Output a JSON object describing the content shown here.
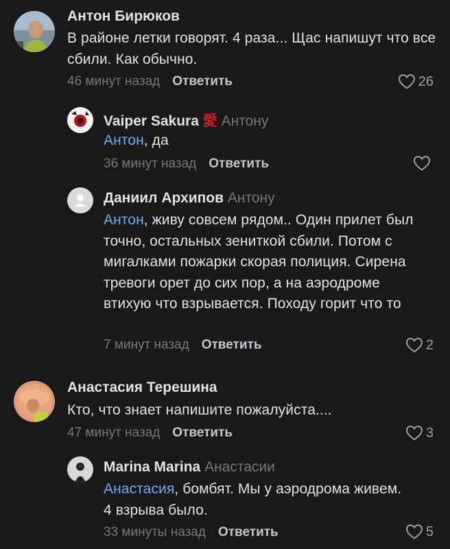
{
  "comments": [
    {
      "author": "Антон Бирюков",
      "text": "В районе летки говорят. 4 раза... Щас напишут что все сбили. Как обычно.",
      "time": "46 минут назад",
      "reply_label": "Ответить",
      "likes": "26",
      "replies": [
        {
          "author": "Vaiper Sakura",
          "emblem": "愛",
          "reply_to": "Антону",
          "mention": "Антон",
          "text": ", да",
          "time": "36 минут назад",
          "reply_label": "Ответить",
          "likes": ""
        },
        {
          "author": "Даниил Архипов",
          "reply_to": "Антону",
          "mention": "Антон",
          "text": ", живу совсем рядом.. Один прилет был точно, остальных зениткой сбили. Потом с мигалками пожарки скорая полиция. Сирена тревоги орет до сих пор, а на аэродроме втихую что взрывается. Походу горит что то",
          "time": "7 минут назад",
          "reply_label": "Ответить",
          "likes": "2"
        }
      ]
    },
    {
      "author": "Анастасия Терешина",
      "text": "Кто, что знает напишите пожалуйста....",
      "time": "47 минут назад",
      "reply_label": "Ответить",
      "likes": "3",
      "replies": [
        {
          "author": "Marina Marina",
          "reply_to": "Анастасии",
          "mention": "Анастасия",
          "text": ", бомбят. Мы у аэродрома живем. 4 взрыва было.",
          "time": "33 минуты назад",
          "reply_label": "Ответить",
          "likes": "5"
        }
      ]
    }
  ],
  "colors": {
    "background": "#19191a",
    "text": "#e1e3e6",
    "secondary": "#76787a",
    "mention": "#71aaeb",
    "action": "#c4c8cc"
  },
  "icons": [
    "heart-icon",
    "default-avatar-icon"
  ]
}
